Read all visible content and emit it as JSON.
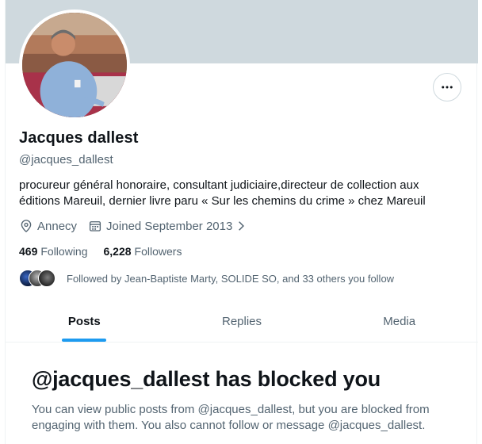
{
  "profile": {
    "name": "Jacques dallest",
    "handle": "@jacques_dallest",
    "bio": "procureur général honoraire, consultant judiciaire,directeur de collection aux éditions Mareuil, dernier livre paru « Sur les chemins du crime » chez Mareuil",
    "location": "Annecy",
    "joined": "Joined September 2013",
    "following_count": "469",
    "following_label": "Following",
    "followers_count": "6,228",
    "followers_label": "Followers",
    "followed_by": "Followed by Jean-Baptiste Marty, SOLIDE SO, and 33 others you follow"
  },
  "icons": {
    "more": "more-horizontal-icon",
    "location": "location-pin-icon",
    "calendar": "calendar-icon",
    "chevron": "chevron-right-icon"
  },
  "tabs": [
    {
      "label": "Posts",
      "active": true
    },
    {
      "label": "Replies",
      "active": false
    },
    {
      "label": "Media",
      "active": false
    }
  ],
  "blocked": {
    "title": "@jacques_dallest has blocked you",
    "text": "You can view public posts from @jacques_dallest, but you are blocked from engaging with them. You also cannot follow or message @jacques_dallest."
  },
  "colors": {
    "banner": "#cfd9de",
    "accent": "#1d9bf0",
    "text_primary": "#0f1419",
    "text_secondary": "#536471"
  }
}
